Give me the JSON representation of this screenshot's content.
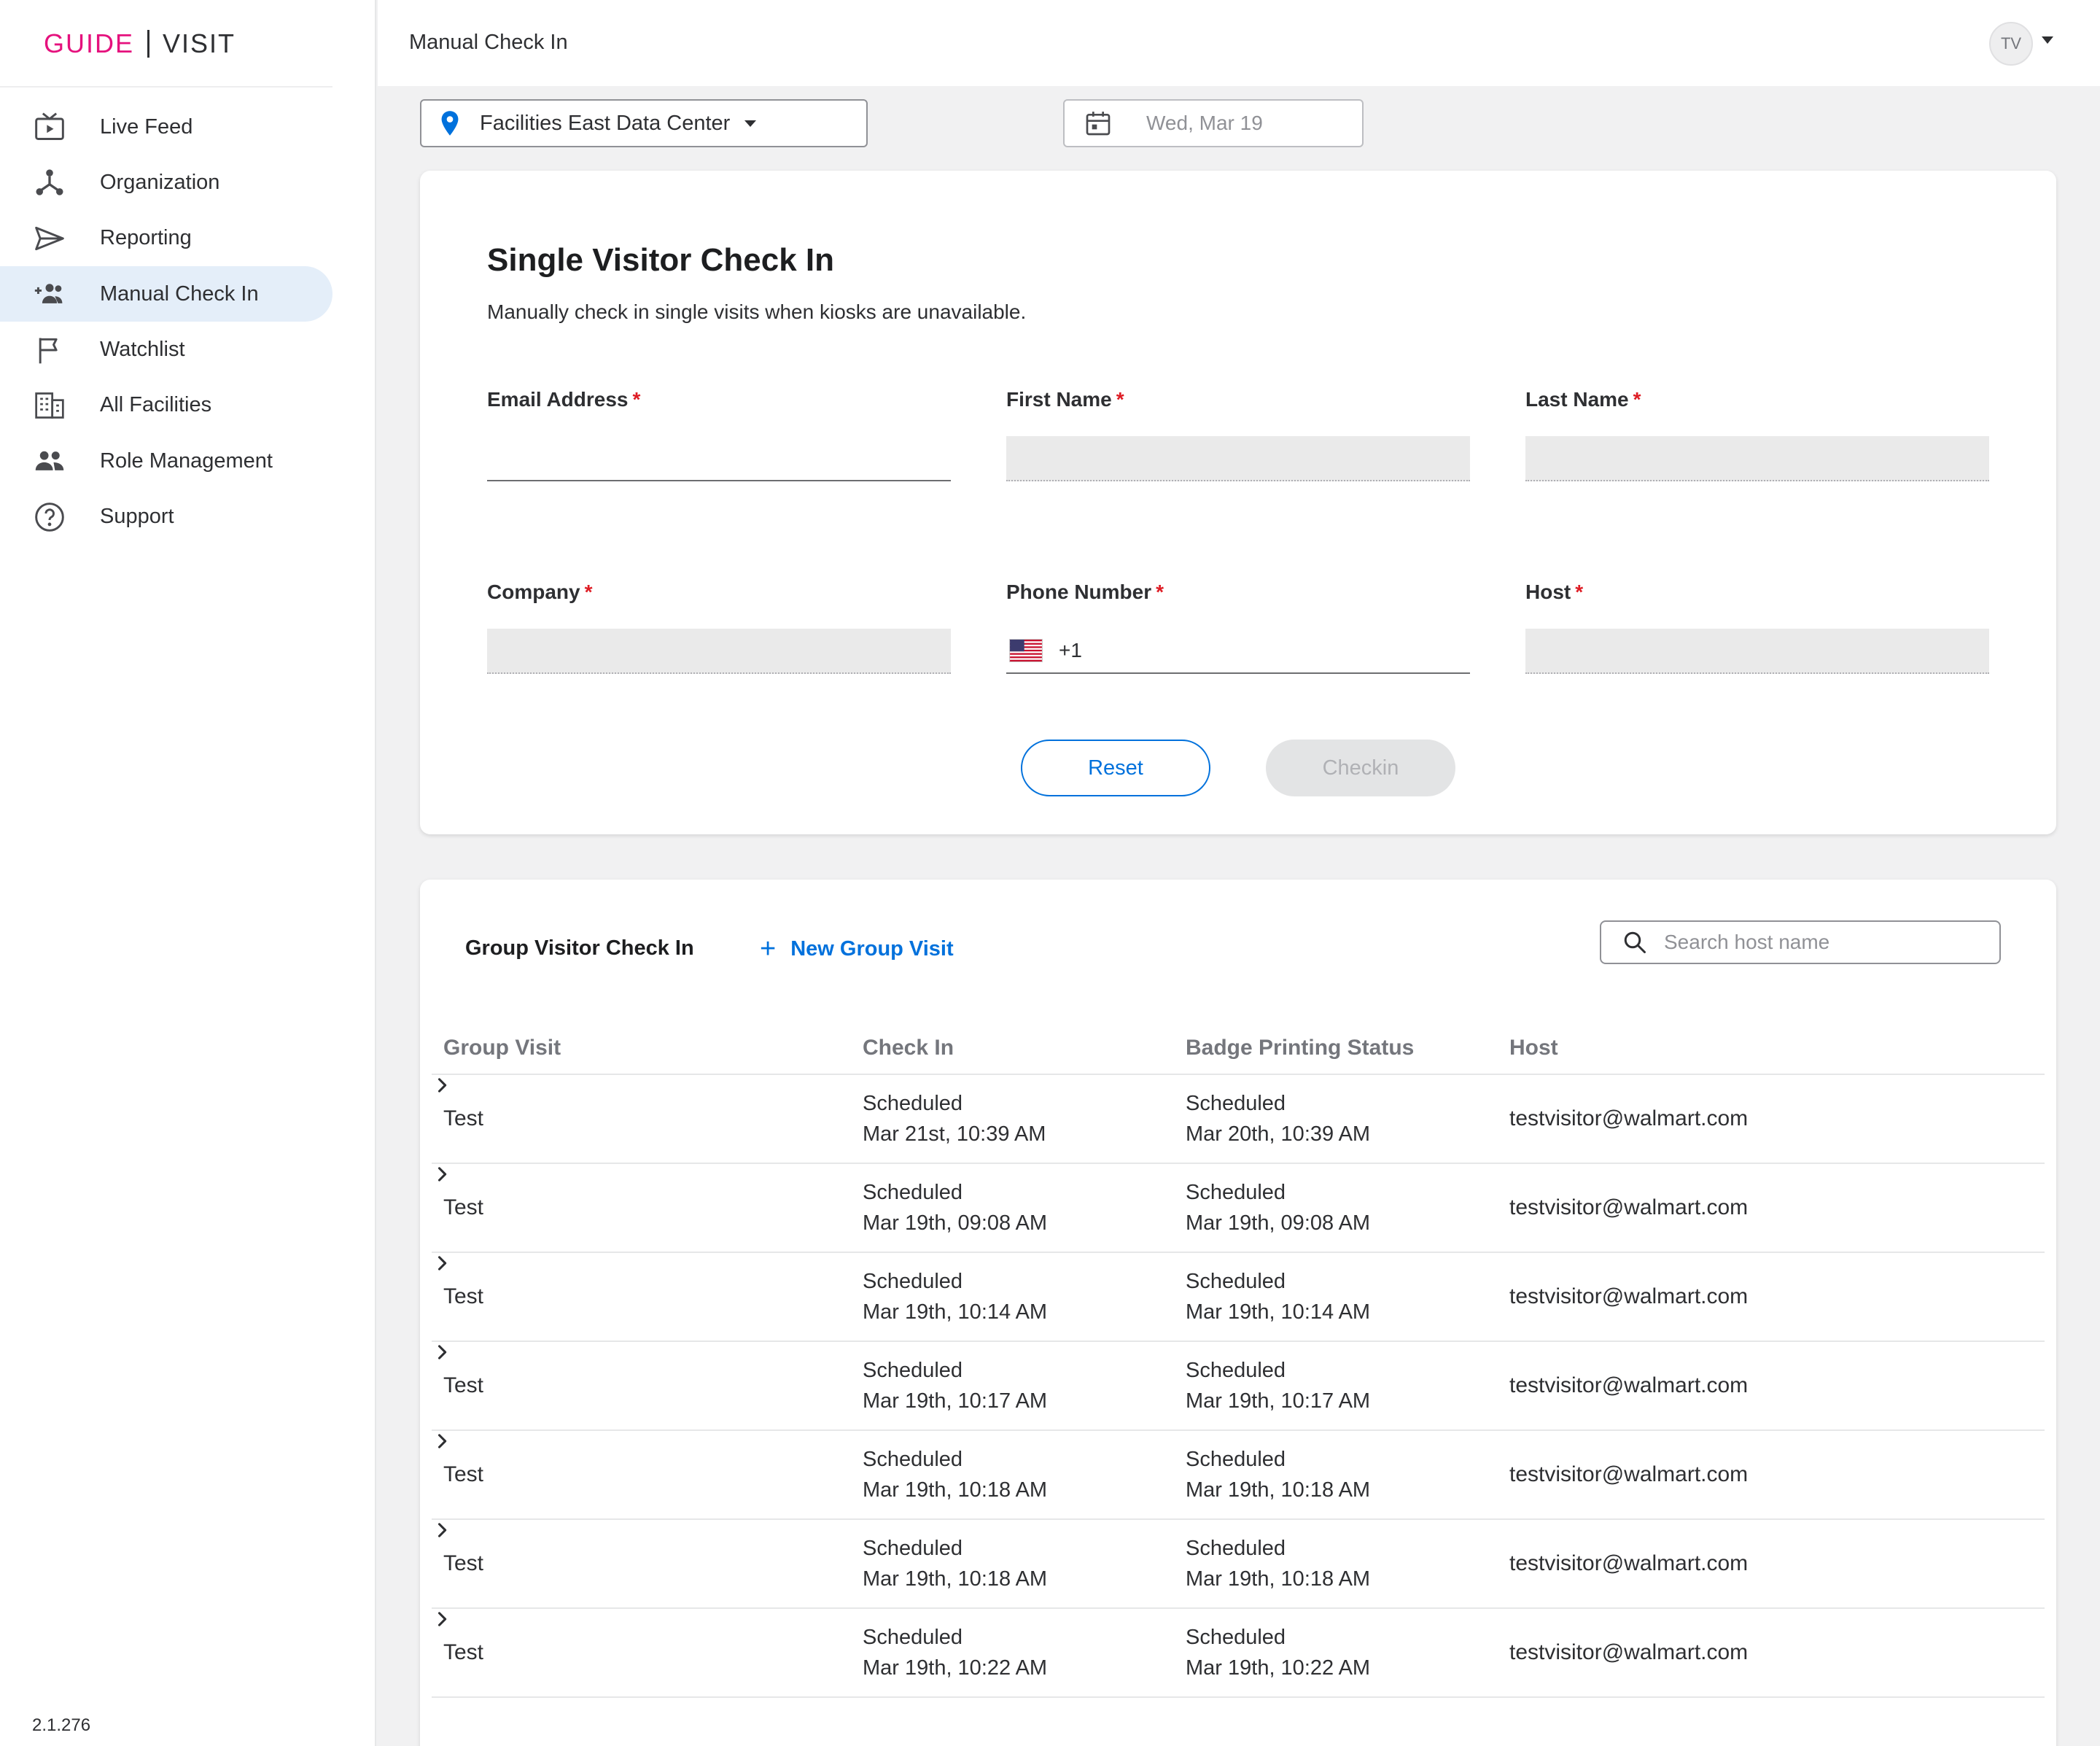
{
  "brand": {
    "left": "GUIDE",
    "right": "VISIT"
  },
  "sidebar": {
    "items": [
      {
        "label": "Live Feed",
        "icon": "live-feed-icon"
      },
      {
        "label": "Organization",
        "icon": "organization-icon"
      },
      {
        "label": "Reporting",
        "icon": "send-icon"
      },
      {
        "label": "Manual Check In",
        "icon": "add-people-icon",
        "active": true
      },
      {
        "label": "Watchlist",
        "icon": "flag-icon"
      },
      {
        "label": "All Facilities",
        "icon": "building-icon"
      },
      {
        "label": "Role Management",
        "icon": "people-icon"
      },
      {
        "label": "Support",
        "icon": "help-icon"
      }
    ],
    "version": "2.1.276"
  },
  "topbar": {
    "title": "Manual Check In",
    "avatar": "TV"
  },
  "filters": {
    "facility": "Facilities East Data Center",
    "date": "Wed, Mar 19"
  },
  "single": {
    "heading": "Single Visitor Check In",
    "subheading": "Manually check in single visits when kiosks are unavailable.",
    "fields": {
      "email": "Email Address",
      "first_name": "First Name",
      "last_name": "Last Name",
      "company": "Company",
      "phone": "Phone Number",
      "phone_prefix": "+1",
      "host": "Host"
    },
    "required_mark": "*",
    "reset": "Reset",
    "checkin": "Checkin"
  },
  "group": {
    "title": "Group Visitor Check In",
    "new_group": "New Group Visit",
    "search_placeholder": "Search host name",
    "columns": [
      "Group Visit",
      "Check In",
      "Badge Printing Status",
      "Host"
    ],
    "rows": [
      {
        "name": "Test",
        "checkin_status": "Scheduled",
        "checkin_time": "Mar 21st, 10:39 AM",
        "badge_status": "Scheduled",
        "badge_time": "Mar 20th, 10:39 AM",
        "host": "testvisitor@walmart.com"
      },
      {
        "name": "Test",
        "checkin_status": "Scheduled",
        "checkin_time": "Mar 19th, 09:08 AM",
        "badge_status": "Scheduled",
        "badge_time": "Mar 19th, 09:08 AM",
        "host": "testvisitor@walmart.com"
      },
      {
        "name": "Test",
        "checkin_status": "Scheduled",
        "checkin_time": "Mar 19th, 10:14 AM",
        "badge_status": "Scheduled",
        "badge_time": "Mar 19th, 10:14 AM",
        "host": "testvisitor@walmart.com"
      },
      {
        "name": "Test",
        "checkin_status": "Scheduled",
        "checkin_time": "Mar 19th, 10:17 AM",
        "badge_status": "Scheduled",
        "badge_time": "Mar 19th, 10:17 AM",
        "host": "testvisitor@walmart.com"
      },
      {
        "name": "Test",
        "checkin_status": "Scheduled",
        "checkin_time": "Mar 19th, 10:18 AM",
        "badge_status": "Scheduled",
        "badge_time": "Mar 19th, 10:18 AM",
        "host": "testvisitor@walmart.com"
      },
      {
        "name": "Test",
        "checkin_status": "Scheduled",
        "checkin_time": "Mar 19th, 10:18 AM",
        "badge_status": "Scheduled",
        "badge_time": "Mar 19th, 10:18 AM",
        "host": "testvisitor@walmart.com"
      },
      {
        "name": "Test",
        "checkin_status": "Scheduled",
        "checkin_time": "Mar 19th, 10:22 AM",
        "badge_status": "Scheduled",
        "badge_time": "Mar 19th, 10:22 AM",
        "host": "testvisitor@walmart.com"
      }
    ]
  },
  "colors": {
    "brand_pink": "#e5117d",
    "accent_blue": "#0071dc",
    "active_nav": "#e4eef9",
    "required": "#de1c24"
  }
}
